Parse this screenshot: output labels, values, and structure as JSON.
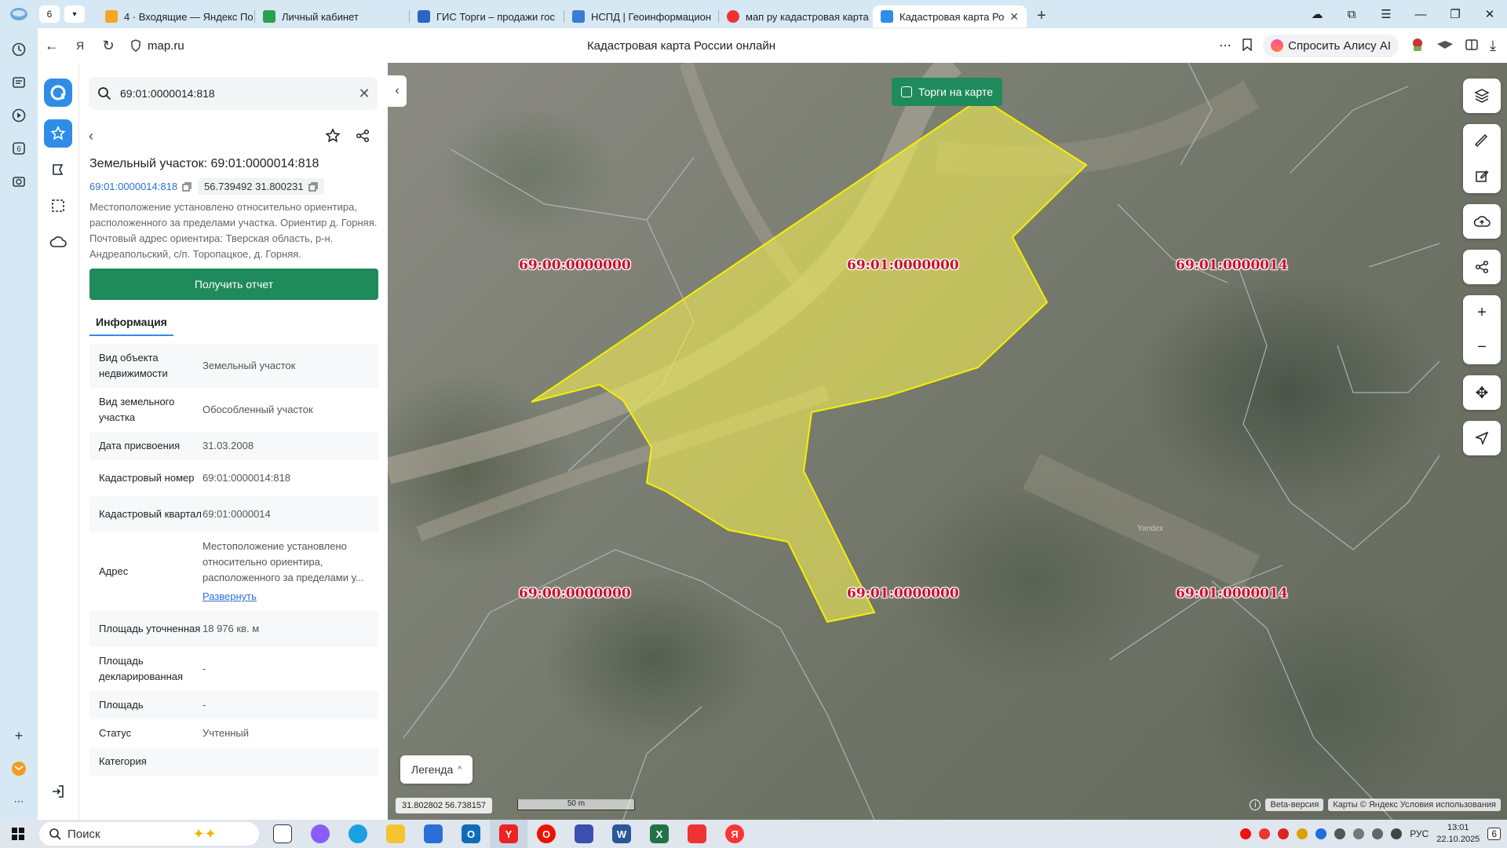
{
  "browser": {
    "tab_count": "6",
    "tabs": [
      {
        "label": "4 · Входящие — Яндекс По",
        "color": "#f5a623"
      },
      {
        "label": "Личный кабинет",
        "color": "#2aa14b"
      },
      {
        "label": "ГИС Торги – продажи гос",
        "color": "#2c64c8"
      },
      {
        "label": "НСПД | Геоинформацион",
        "color": "#3a7bd5"
      },
      {
        "label": "мап ру кадастровая карта",
        "color": "#e33"
      },
      {
        "label": "Кадастровая карта Рос",
        "color": "#2f8de8",
        "active": true
      }
    ],
    "url": "map.ru",
    "page_title": "Кадастровая карта России онлайн",
    "alisa_label": "Спросить Алису AI"
  },
  "panel": {
    "search_value": "69:01:0000014:818",
    "title": "Земельный участок: 69:01:0000014:818",
    "code_link": "69:01:0000014:818",
    "coords_chip": "56.739492 31.800231",
    "description": "Местоположение установлено относительно ориентира, расположенного за пределами участка. Ориентир д. Горняя. Почтовый адрес ориентира: Тверская область, р-н. Андреапольский, с/п. Торопацкое, д. Горняя.",
    "report_button": "Получить отчет",
    "tab_info": "Информация",
    "expand_label": "Развернуть",
    "rows": [
      {
        "k": "Вид объекта недвижимости",
        "v": "Земельный участок"
      },
      {
        "k": "Вид земельного участка",
        "v": "Обособленный участок"
      },
      {
        "k": "Дата присвоения",
        "v": "31.03.2008"
      },
      {
        "k": "Кадастровый номер",
        "v": "69:01:0000014:818"
      },
      {
        "k": "Кадастровый квартал",
        "v": "69:01:0000014"
      },
      {
        "k": "Адрес",
        "v": "Местоположение установлено относительно ориентира, расположенного за пределами у..."
      },
      {
        "k": "Площадь уточненная",
        "v": "18 976 кв. м"
      },
      {
        "k": "Площадь декларированная",
        "v": "-"
      },
      {
        "k": "Площадь",
        "v": "-"
      },
      {
        "k": "Статус",
        "v": "Учтенный"
      },
      {
        "k": "Категория",
        "v": ""
      }
    ]
  },
  "map": {
    "torgi_label": "Торги на карте",
    "labels": [
      "69:00:0000000",
      "69:01:0000000",
      "69:01:0000014",
      "69:00:0000000",
      "69:01:0000000",
      "69:01:0000014"
    ],
    "legend_label": "Легенда",
    "cursor_coords": "31.802802   56.738157",
    "scale_label": "50 m",
    "beta_label": "Beta-версия",
    "attribution": "Карты © Яндекс  Условия использования",
    "watermark": "Yandex",
    "parcel_fill": "#f3ee55",
    "parcel_stroke": "#f4f000",
    "quarter_stroke": "#b9bec2"
  },
  "taskbar": {
    "search_placeholder": "Поиск",
    "lang": "РУС",
    "time": "13:01",
    "date": "22.10.2025",
    "notif": "6"
  }
}
